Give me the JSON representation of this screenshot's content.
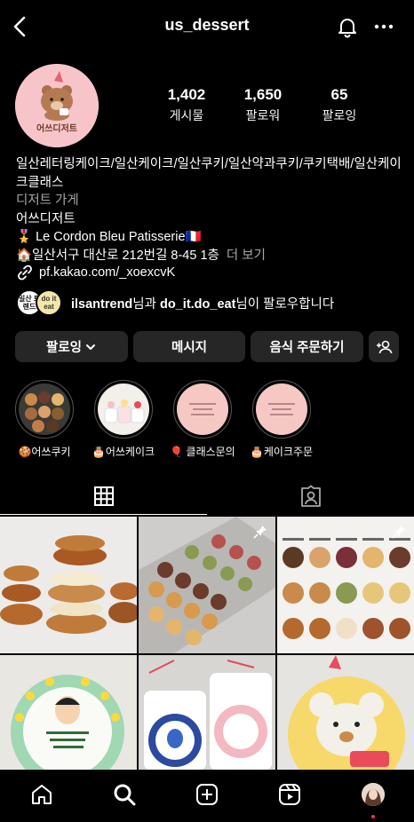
{
  "header": {
    "username": "us_dessert",
    "back_icon": "chevron-left-icon",
    "bell_icon": "bell-icon",
    "more_icon": "more-horizontal-icon"
  },
  "profile": {
    "avatar_brand": "어쓰디저트",
    "stats": [
      {
        "value": "1,402",
        "label": "게시물"
      },
      {
        "value": "1,650",
        "label": "팔로워"
      },
      {
        "value": "65",
        "label": "팔로잉"
      }
    ],
    "bio": {
      "name": "일산레터링케이크/일산케이크/일산쿠키/일산약과쿠키/쿠키택배/일산케이크클래스",
      "category": "디저트 가게",
      "line1": "어쓰디저트",
      "line2": "🎖️ Le Cordon Bleu Patisserie🇫🇷",
      "line3": "🏠일산서구 대산로 212번길 8-45 1층",
      "more": "더 보기"
    },
    "link": "pf.kakao.com/_xoexcvK",
    "followed_by": {
      "avatar1_text": "일산 트렌드",
      "avatar2_text": "do it eat",
      "user1": "ilsantrend",
      "connector": "님과 ",
      "user2": "do_it.do_eat",
      "suffix": "님이 팔로우합니다"
    }
  },
  "buttons": {
    "following": "팔로잉",
    "message": "메시지",
    "order": "음식 주문하기"
  },
  "highlights": [
    {
      "label": "🍪어쓰쿠키"
    },
    {
      "label": "🎂어쓰케이크"
    },
    {
      "label": "🎈 클래스문의"
    },
    {
      "label": "🎂케이크주문"
    }
  ],
  "colors": {
    "background": "#000000",
    "button": "#262626",
    "secondary_text": "#a8a8a8",
    "notification_dot": "#ff3040"
  }
}
